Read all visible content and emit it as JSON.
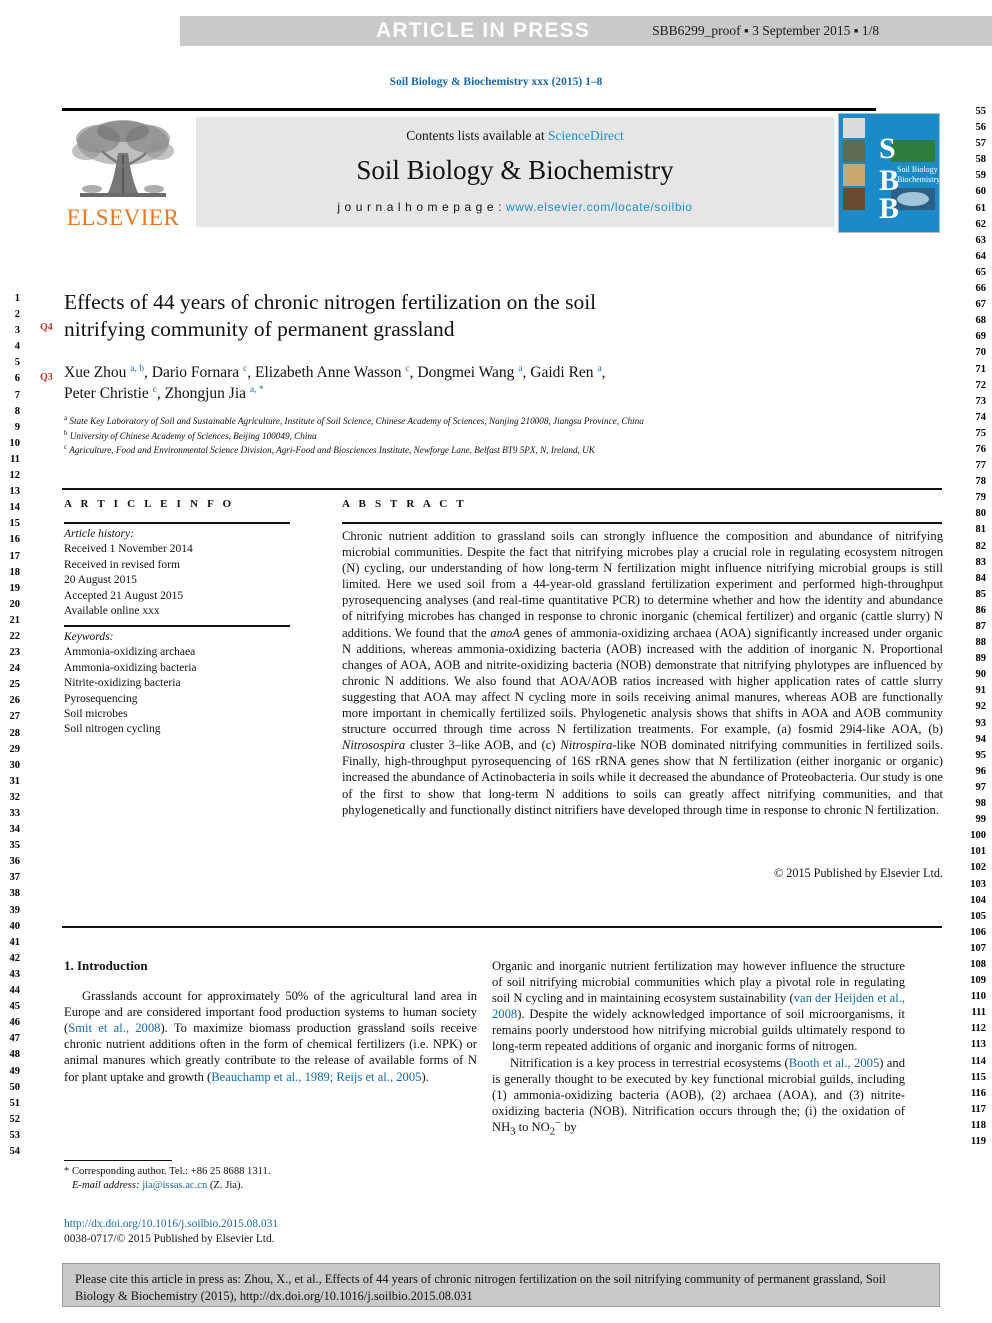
{
  "press_bar": {
    "title": "ARTICLE IN PRESS",
    "proof_info": "SBB6299_proof ▪ 3 September 2015 ▪ 1/8"
  },
  "journal_line": "Soil Biology & Biochemistry xxx (2015) 1–8",
  "masthead": {
    "contents_prefix": "Contents lists available at ",
    "sciencedirect": "ScienceDirect",
    "journal_name": "Soil Biology & Biochemistry",
    "homepage_label": "j o u r n a l   h o m e p a g e :  ",
    "homepage_url": "www.elsevier.com/locate/soilbio",
    "publisher_wordmark": "ELSEVIER",
    "cover_letters": [
      "S",
      "B",
      "B"
    ],
    "cover_caption": "Soil Biology & Biochemistry"
  },
  "article": {
    "title_line1": "Effects of 44 years of chronic nitrogen fertilization on the soil",
    "title_line2": "nitrifying community of permanent grassland",
    "query_marks": [
      "Q4",
      "Q3"
    ],
    "authors_line1": "Xue Zhou a, b, Dario Fornara c, Elizabeth Anne Wasson c, Dongmei Wang a, Gaidi Ren a,",
    "authors_line2": "Peter Christie c, Zhongjun Jia a, *",
    "affiliations": [
      {
        "mark": "a",
        "text": "State Key Laboratory of Soil and Sustainable Agriculture, Institute of Soil Science, Chinese Academy of Sciences, Nanjing 210008, Jiangsu Province, China"
      },
      {
        "mark": "b",
        "text": "University of Chinese Academy of Sciences, Beijing 100049, China"
      },
      {
        "mark": "c",
        "text": "Agriculture, Food and Environmental Science Division, Agri-Food and Biosciences Institute, Newforge Lane, Belfast BT9 5PX, N, Ireland, UK"
      }
    ]
  },
  "article_info": {
    "heading": "A R T I C L E   I N F O",
    "history_label": "Article history:",
    "history": [
      "Received 1 November 2014",
      "Received in revised form",
      "20 August 2015",
      "Accepted 21 August 2015",
      "Available online xxx"
    ],
    "keywords_label": "Keywords:",
    "keywords": [
      "Ammonia-oxidizing archaea",
      "Ammonia-oxidizing bacteria",
      "Nitrite-oxidizing bacteria",
      "Pyrosequencing",
      "Soil microbes",
      "Soil nitrogen cycling"
    ]
  },
  "abstract": {
    "heading": "A B S T R A C T",
    "part1": "Chronic nutrient addition to grassland soils can strongly influence the composition and abundance of nitrifying microbial communities. Despite the fact that nitrifying microbes play a crucial role in regulating ecosystem nitrogen (N) cycling, our understanding of how long-term N fertilization might influence nitrifying microbial groups is still limited. Here we used soil from a 44-year-old grassland fertilization experiment and performed high-throughput pyrosequencing analyses (and real-time quantitative PCR) to determine whether and how the identity and abundance of nitrifying microbes has changed in response to chronic inorganic (chemical fertilizer) and organic (cattle slurry) N additions. We found that the ",
    "italic1": "amoA",
    "part2": " genes of ammonia-oxidizing archaea (AOA) significantly increased under organic N additions, whereas ammonia-oxidizing bacteria (AOB) increased with the addition of inorganic N. Proportional changes of AOA, AOB and nitrite-oxidizing bacteria (NOB) demonstrate that nitrifying phylotypes are influenced by chronic N additions. We also found that AOA/AOB ratios increased with higher application rates of cattle slurry suggesting that AOA may affect N cycling more in soils receiving animal manures, whereas AOB are functionally more important in chemically fertilized soils. Phylogenetic analysis shows that shifts in AOA and AOB community structure occurred through time across N fertilization treatments. For example, (a) fosmid 29i4-like AOA, (b) ",
    "italic2": "Nitrosospira",
    "part3": " cluster 3–like AOB, and (c) ",
    "italic3": "Nitrospira",
    "part4": "-like NOB dominated nitrifying communities in fertilized soils. Finally, high-throughput pyrosequencing of 16S rRNA genes show that N fertilization (either inorganic or organic) increased the abundance of Actinobacteria in soils while it decreased the abundance of Proteobacteria. Our study is one of the first to show that long-term N additions to soils can greatly affect nitrifying communities, and that phylogenetically and functionally distinct nitrifiers have developed through time in response to chronic N fertilization.",
    "copyright": "© 2015 Published by Elsevier Ltd."
  },
  "introduction": {
    "heading": "1.  Introduction",
    "left_p1_a": "Grasslands account for approximately 50% of the agricultural land area in Europe and are considered important food production systems to human society (",
    "left_ref1": "Smit et al., 2008",
    "left_p1_b": "). To maximize biomass production grassland soils receive chronic nutrient additions often in the form of chemical fertilizers (i.e. NPK) or animal manures which greatly contribute to the release of available forms of N for plant uptake and growth (",
    "left_ref2": "Beauchamp et al., 1989; Reijs et al., 2005",
    "left_p1_c": ").",
    "right_p1_a": "Organic and inorganic nutrient fertilization may however influence the structure of soil nitrifying microbial communities which play a pivotal role in regulating soil N cycling and in maintaining ecosystem sustainability (",
    "right_ref1": "van der Heijden et al., 2008",
    "right_p1_b": "). Despite the widely acknowledged importance of soil microorganisms, it remains poorly understood how nitrifying microbial guilds ultimately respond to long-term repeated additions of organic and inorganic forms of nitrogen.",
    "right_p2_a": "Nitrification is a key process in terrestrial ecosystems (",
    "right_ref2": "Booth et al., 2005",
    "right_p2_b": ") and is generally thought to be executed by key functional microbial guilds, including (1) ammonia-oxidizing bacteria (AOB), (2) archaea (AOA), and (3) nitrite-oxidizing bacteria (NOB). Nitrification occurs through the; (i) the oxidation of NH",
    "right_sub1": "3",
    "right_p2_c": " to NO",
    "right_sub2": "2",
    "right_sup2": "−",
    "right_p2_d": " by"
  },
  "footnote": {
    "corresponding": "* Corresponding author. Tel.: +86 25 8688 1311.",
    "email_label": "E-mail address:",
    "email": "jia@issas.ac.cn",
    "email_suffix": " (Z. Jia)."
  },
  "doi_block": {
    "doi": "http://dx.doi.org/10.1016/j.soilbio.2015.08.031",
    "issn_line": "0038-0717/© 2015 Published by Elsevier Ltd."
  },
  "citation_box": {
    "text": "Please cite this article in press as: Zhou, X., et al., Effects of 44 years of chronic nitrogen fertilization on the soil nitrifying community of permanent grassland, Soil Biology & Biochemistry (2015), http://dx.doi.org/10.1016/j.soilbio.2015.08.031"
  },
  "line_numbers": {
    "left_start": 1,
    "left_end": 54,
    "right_start": 55,
    "right_end": 119
  },
  "colors": {
    "link": "#1668a8",
    "sciencedirect": "#1e8fc6",
    "elsevier_orange": "#e87722",
    "query_red": "#c0392b",
    "press_bar_gray": "#c9c9c9",
    "masthead_gray": "#e6e6e6",
    "cover_blue": "#1b8bc8"
  }
}
